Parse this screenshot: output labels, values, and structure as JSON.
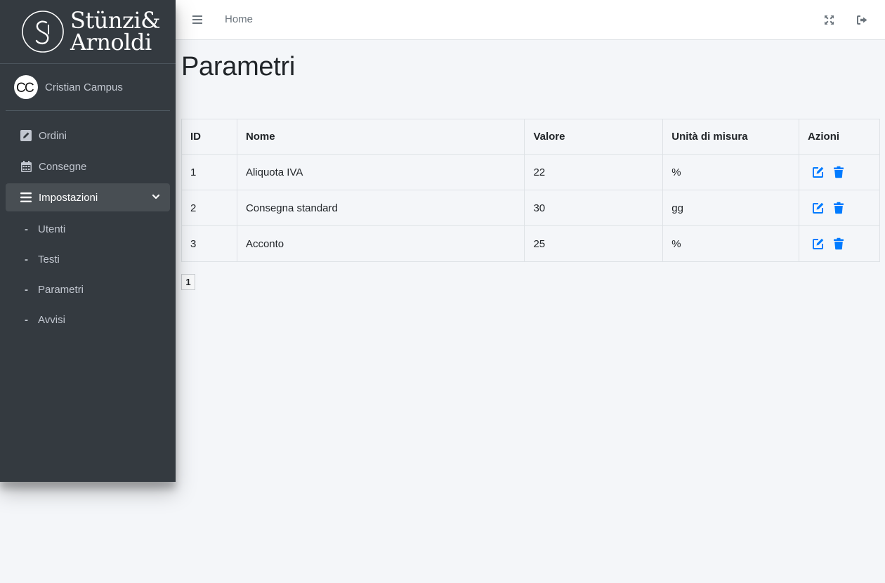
{
  "brand": {
    "line1": "Stünzi&",
    "line2": "Arnoldi"
  },
  "user": {
    "initials": "CC",
    "name": "Cristian Campus"
  },
  "sidebar": {
    "items": [
      {
        "label": "Ordini",
        "icon": "edit-square-icon"
      },
      {
        "label": "Consegne",
        "icon": "calendar-icon"
      },
      {
        "label": "Impostazioni",
        "icon": "bars-icon",
        "expanded": true
      }
    ],
    "sub_items": [
      {
        "label": "Utenti"
      },
      {
        "label": "Testi"
      },
      {
        "label": "Parametri"
      },
      {
        "label": "Avvisi"
      }
    ]
  },
  "navbar": {
    "home": "Home"
  },
  "page": {
    "title": "Parametri"
  },
  "table": {
    "headers": [
      "ID",
      "Nome",
      "Valore",
      "Unità di misura",
      "Azioni"
    ],
    "rows": [
      {
        "id": "1",
        "nome": "Aliquota IVA",
        "valore": "22",
        "unita": "%"
      },
      {
        "id": "2",
        "nome": "Consegna standard",
        "valore": "30",
        "unita": "gg"
      },
      {
        "id": "3",
        "nome": "Acconto",
        "valore": "25",
        "unita": "%"
      }
    ]
  },
  "pagination": {
    "current": "1"
  },
  "colors": {
    "sidebar": "#343a40",
    "accent": "#007bff",
    "background": "#f4f6f9"
  }
}
